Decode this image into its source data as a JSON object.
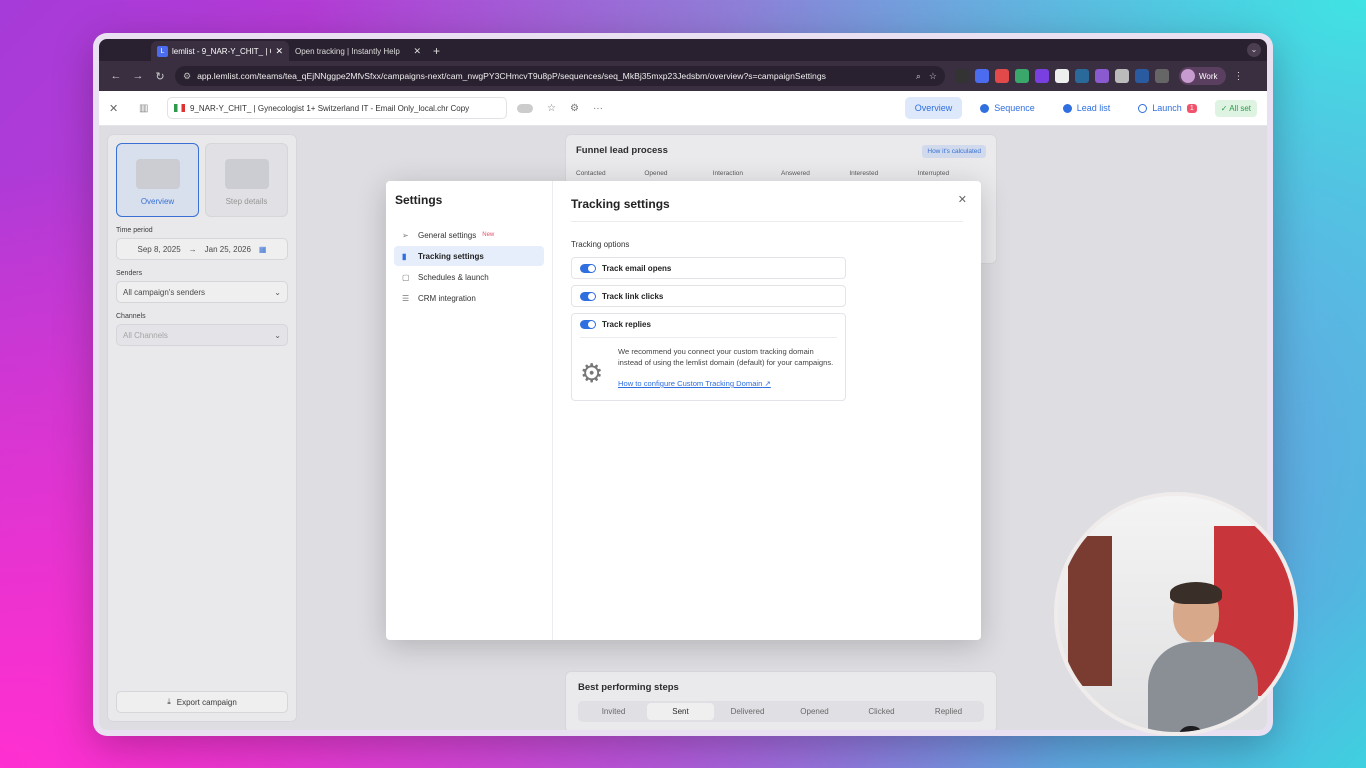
{
  "browser": {
    "tabs": [
      {
        "title": "lemlist - 9_NAR-Y_CHIT_ | G",
        "active": true
      },
      {
        "title": "Open tracking | Instantly Help",
        "active": false
      }
    ],
    "url": "app.lemlist.com/teams/tea_qEjNNggpe2MfvSfxx/campaigns-next/cam_nwgPY3CHmcvT9u8pP/sequences/seq_MkBj35mxp23Jedsbm/overview?s=campaignSettings",
    "profile_label": "Work"
  },
  "header": {
    "campaign_name": "9_NAR-Y_CHIT_ | Gynecologist 1+ Switzerland IT - Email Only_local.chr Copy",
    "tabs": {
      "overview": "Overview",
      "sequence": "Sequence",
      "lead_list": "Lead list",
      "launch": "Launch",
      "launch_badge": "1"
    },
    "status": "All set"
  },
  "left_panel": {
    "view_overview": "Overview",
    "view_step_details": "Step details",
    "time_period_label": "Time period",
    "date_from": "Sep 8, 2025",
    "date_to": "Jan 25, 2026",
    "senders_label": "Senders",
    "senders_value": "All campaign's senders",
    "channels_label": "Channels",
    "channels_value": "All Channels",
    "export_label": "Export campaign"
  },
  "funnel": {
    "title": "Funnel lead process",
    "how_label": "How it's calculated",
    "columns": [
      "Contacted",
      "Opened",
      "Interaction",
      "Answered",
      "Interested",
      "Interrupted"
    ]
  },
  "best_performing": {
    "title": "Best performing steps",
    "tabs": [
      "Invited",
      "Sent",
      "Delivered",
      "Opened",
      "Clicked",
      "Replied"
    ],
    "active_tab": "Sent"
  },
  "settings_modal": {
    "title": "Settings",
    "nav": [
      {
        "label": "General settings",
        "badge": "New"
      },
      {
        "label": "Tracking settings",
        "badge": ""
      },
      {
        "label": "Schedules & launch",
        "badge": ""
      },
      {
        "label": "CRM integration",
        "badge": ""
      }
    ],
    "active_nav": "Tracking settings",
    "heading": "Tracking settings",
    "section_label": "Tracking options",
    "options": [
      {
        "label": "Track email opens",
        "enabled": true
      },
      {
        "label": "Track link clicks",
        "enabled": true
      },
      {
        "label": "Track replies",
        "enabled": true
      }
    ],
    "recommendation": "We recommend you connect your custom tracking domain instead of using the lemlist domain (default) for your campaigns.",
    "link_text": "How to configure Custom Tracking Domain"
  },
  "colors": {
    "accent": "#2f6fe0",
    "active_bg": "#e6eefc",
    "badge_red": "#f0536b",
    "all_set_green": "#2d9a4a"
  }
}
